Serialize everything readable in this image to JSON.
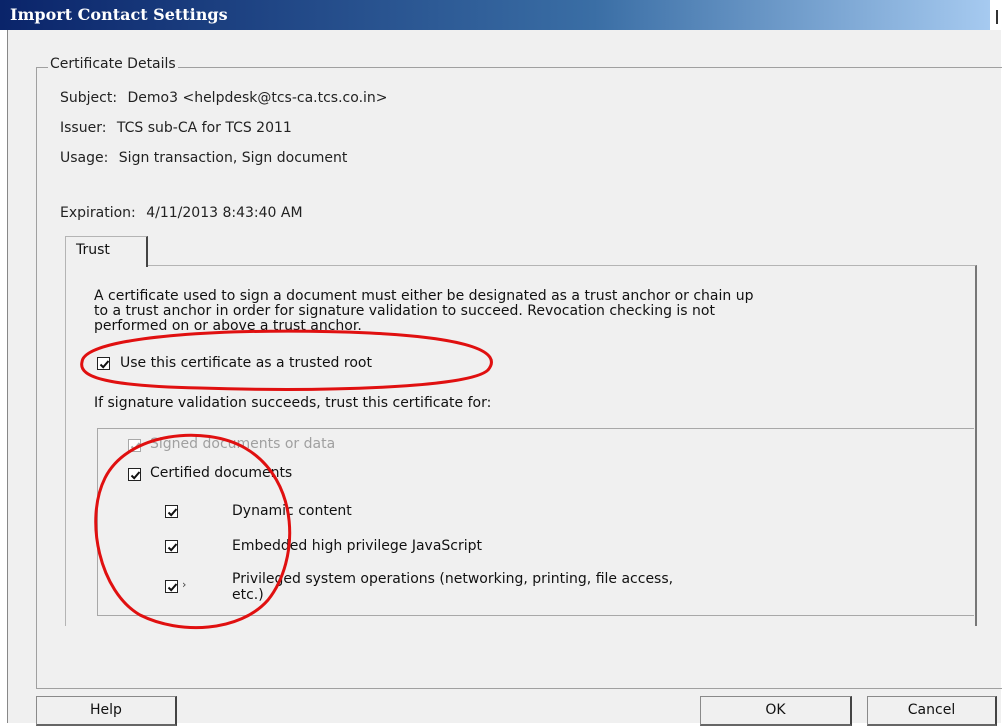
{
  "window": {
    "title": "Import Contact Settings"
  },
  "certificate": {
    "section_label": "Certificate Details",
    "subject_label": "Subject:",
    "subject_value": "Demo3 <helpdesk@tcs-ca.tcs.co.in>",
    "issuer_label": "Issuer:",
    "issuer_value": "TCS sub-CA for TCS 2011",
    "usage_label": "Usage:",
    "usage_value": "Sign transaction, Sign document",
    "expiration_label": "Expiration:",
    "expiration_value": "4/11/2013 8:43:40 AM"
  },
  "tabs": [
    {
      "label": "Trust",
      "active": true
    }
  ],
  "trust": {
    "description_lines": [
      "A certificate used to sign a document must either be designated as a trust anchor or chain up",
      "to a trust anchor in order for signature validation to succeed.  Revocation checking is not",
      "performed on or above a trust anchor."
    ],
    "trusted_root_label": "Use this certificate as a trusted root",
    "trusted_root_checked": true,
    "trust_for_label": "If signature validation succeeds, trust this certificate for:",
    "options": [
      {
        "label": "Signed documents or data",
        "checked": true,
        "disabled": true
      },
      {
        "label": "Certified documents",
        "checked": true,
        "disabled": false
      },
      {
        "label": "Dynamic content",
        "checked": true,
        "disabled": false
      },
      {
        "label": "Embedded high privilege JavaScript",
        "checked": true,
        "disabled": false
      },
      {
        "label_line1": "Privileged system operations (networking, printing, file access,",
        "label_line2": "etc.)",
        "checked": true,
        "disabled": false
      }
    ]
  },
  "buttons": {
    "help": "Help",
    "ok": "OK",
    "cancel": "Cancel"
  },
  "colors": {
    "titlebar_start": "#0a246a",
    "annotation_red": "#e01010",
    "dialog_bg": "#f0f0f0"
  },
  "annotations": {
    "shape": "red hand-drawn ellipses",
    "count": 2
  }
}
